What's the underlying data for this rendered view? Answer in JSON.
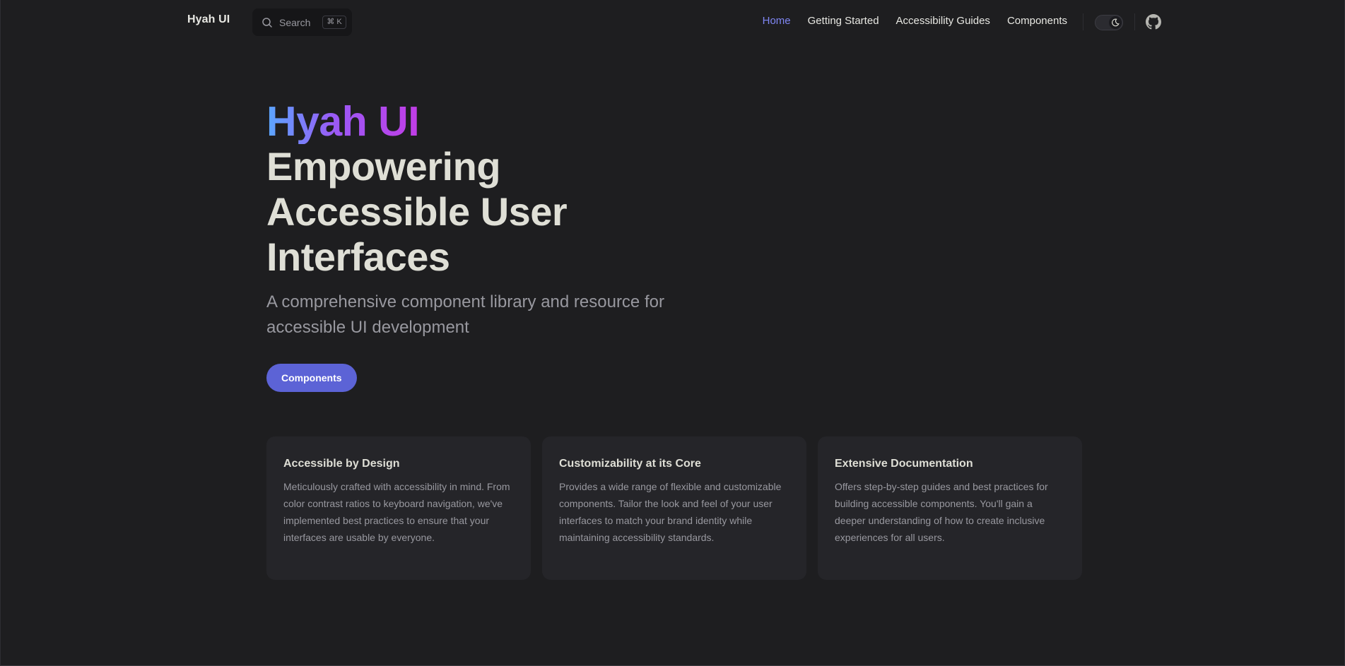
{
  "nav": {
    "brand": "Hyah UI",
    "search": {
      "label": "Search",
      "shortcut": "⌘ K"
    },
    "links": [
      {
        "label": "Home",
        "active": true
      },
      {
        "label": "Getting Started",
        "active": false
      },
      {
        "label": "Accessibility Guides",
        "active": false
      },
      {
        "label": "Components",
        "active": false
      }
    ],
    "theme_toggle_icon": "moon-icon",
    "github_icon": "github-icon"
  },
  "hero": {
    "name": "Hyah UI",
    "text": "Empowering Accessible User Interfaces",
    "tagline": "A comprehensive component library and resource for accessible UI development",
    "action_label": "Components"
  },
  "features": [
    {
      "title": "Accessible by Design",
      "details": "Meticulously crafted with accessibility in mind. From color contrast ratios to keyboard navigation, we've implemented best practices to ensure that your interfaces are usable by everyone."
    },
    {
      "title": "Customizability at its Core",
      "details": "Provides a wide range of flexible and customizable components. Tailor the look and feel of your user interfaces to match your brand identity while maintaining accessibility standards."
    },
    {
      "title": "Extensive Documentation",
      "details": "Offers step-by-step guides and best practices for building accessible components. You'll gain a deeper understanding of how to create inclusive experiences for all users."
    }
  ],
  "colors": {
    "background": "#1e1e20",
    "accent": "#5c63d6",
    "active_link": "#7f86f3",
    "card": "#252529",
    "gradient_start": "#5aa7ff",
    "gradient_end": "#c13de6"
  }
}
